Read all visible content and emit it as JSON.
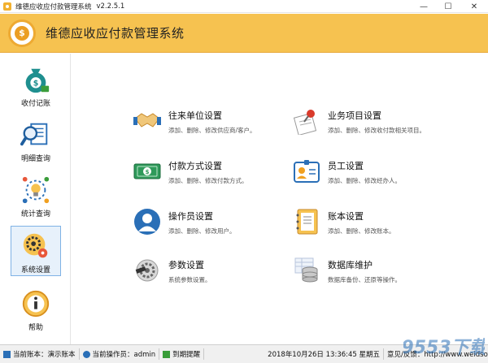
{
  "window": {
    "title": "维德应收应付款管理系统",
    "version": "v2.2.5.1",
    "controls": {
      "minimize": "—",
      "maximize": "☐",
      "close": "✕"
    }
  },
  "header": {
    "title": "维德应收应付款管理系统",
    "logo_symbol": "$"
  },
  "sidebar": {
    "items": [
      {
        "label": "收付记账",
        "icon": "money-bag-icon"
      },
      {
        "label": "明细查询",
        "icon": "magnifier-document-icon"
      },
      {
        "label": "统计查询",
        "icon": "lightbulb-stats-icon"
      },
      {
        "label": "系统设置",
        "icon": "gears-icon",
        "active": true
      },
      {
        "label": "帮助",
        "icon": "info-icon"
      }
    ]
  },
  "main": {
    "cards": [
      {
        "title": "往来单位设置",
        "desc": "添加、删除、修改供应商/客户。",
        "icon": "handshake-icon"
      },
      {
        "title": "业务项目设置",
        "desc": "添加、删除、修改收付款相关项目。",
        "icon": "pushpin-note-icon"
      },
      {
        "title": "付款方式设置",
        "desc": "添加、删除、修改付款方式。",
        "icon": "cash-bill-icon"
      },
      {
        "title": "员工设置",
        "desc": "添加、删除、修改经办人。",
        "icon": "id-badge-icon"
      },
      {
        "title": "操作员设置",
        "desc": "添加、删除、修改用户。",
        "icon": "operator-icon"
      },
      {
        "title": "账本设置",
        "desc": "添加、删除、修改账本。",
        "icon": "ledger-book-icon"
      },
      {
        "title": "参数设置",
        "desc": "系统参数设置。",
        "icon": "parameter-gear-icon"
      },
      {
        "title": "数据库维护",
        "desc": "数据库备份、还原等操作。",
        "icon": "database-icon"
      }
    ]
  },
  "statusbar": {
    "ledger": "当前账本：演示账本",
    "operator": "当前操作员：admin",
    "reminder": "到期提醒",
    "datetime": "2018年10月26日 13:36:45 星期五",
    "website": "意见/反馈：http://www.weidsoft.com"
  },
  "watermark": {
    "text": "9553下载"
  },
  "colors": {
    "header_bg": "#f6c250",
    "accent_orange": "#eb9e23",
    "active_nav_bg": "#e7f1fb",
    "active_nav_border": "#7fb2e5",
    "icon_blue": "#2a6fb7",
    "icon_teal": "#1f8f8f"
  }
}
